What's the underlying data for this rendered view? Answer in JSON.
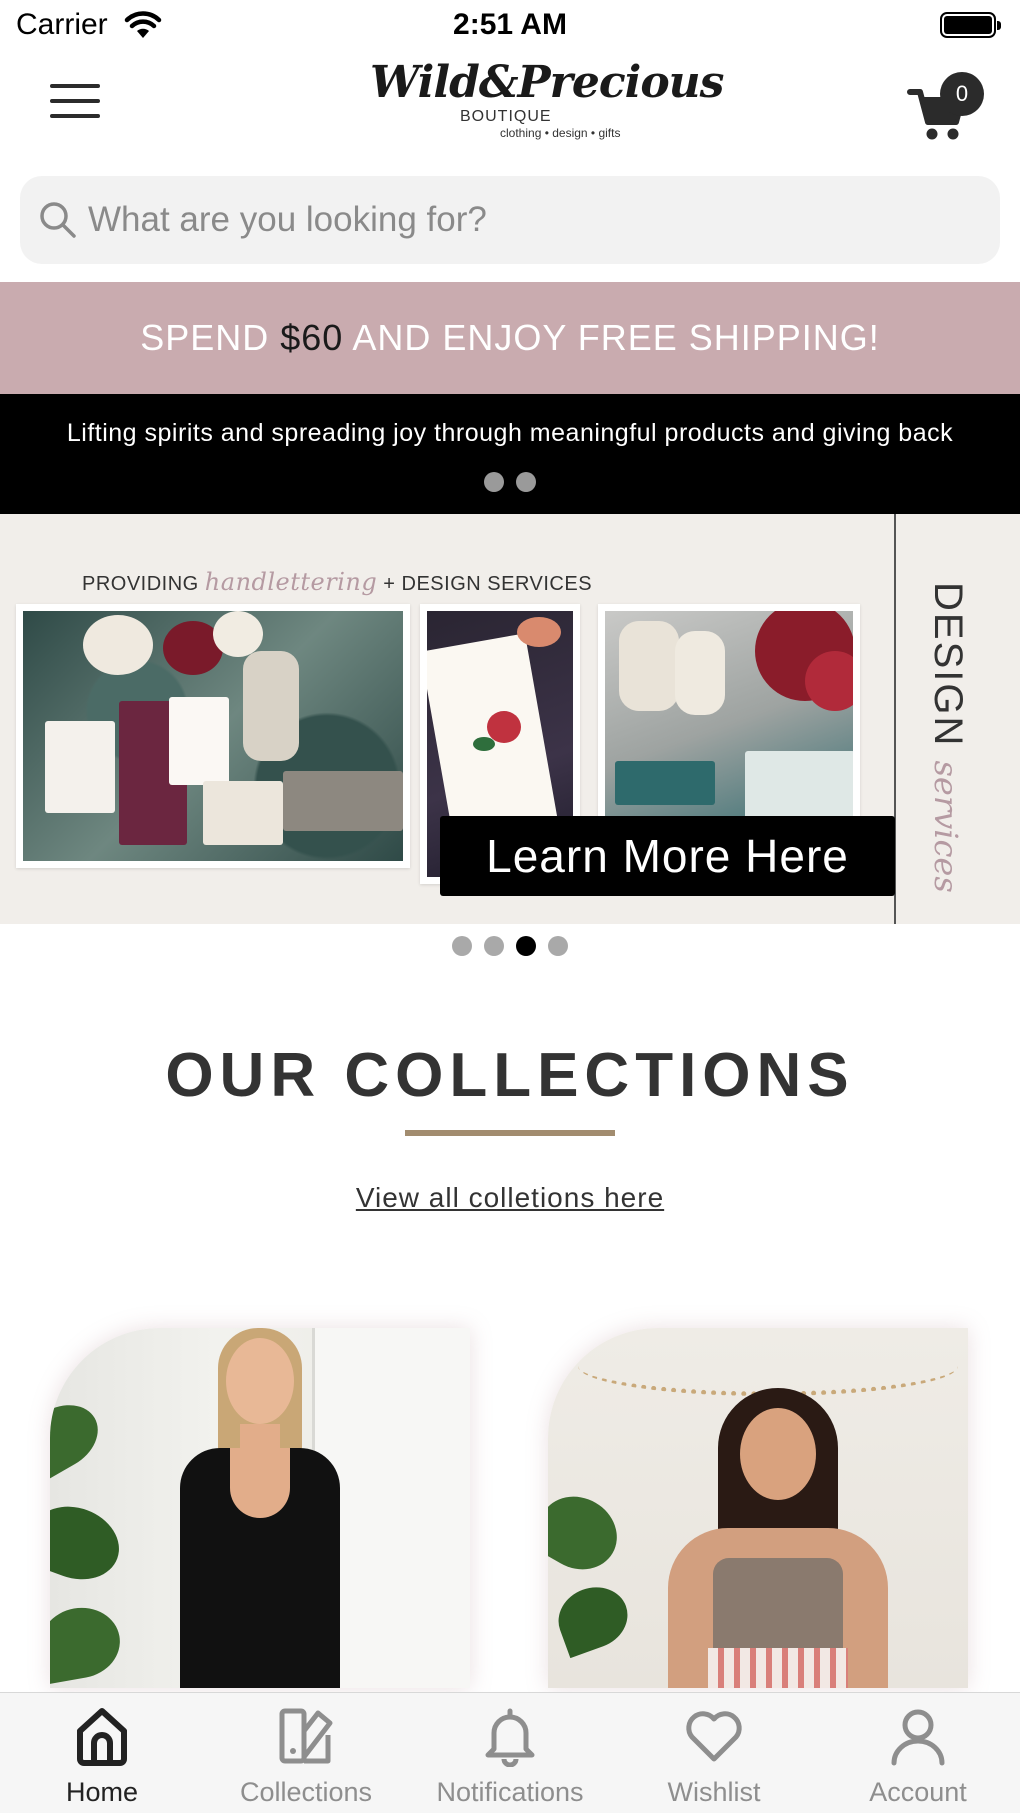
{
  "status_bar": {
    "carrier": "Carrier",
    "time": "2:51 AM"
  },
  "header": {
    "logo_main": "Wild&Precious",
    "logo_sub": "BOUTIQUE",
    "logo_tag": "clothing • design • gifts",
    "cart_count": "0"
  },
  "search": {
    "placeholder": "What are you looking for?"
  },
  "promo": {
    "shipping_prefix": "SPEND ",
    "shipping_amount": "$60",
    "shipping_suffix": " AND ENJOY FREE SHIPPING!",
    "tagline": "Lifting spirits and spreading joy through meaningful products and giving back"
  },
  "hero": {
    "heading_prefix": "PROVIDING ",
    "heading_script": "handlettering",
    "heading_suffix": " + DESIGN SERVICES",
    "side_label": "DESIGN",
    "side_script": "services",
    "button_label": "Learn More Here",
    "active_slide": 3,
    "slide_count": 4
  },
  "collections": {
    "title": "OUR COLLECTIONS",
    "view_all": "View all colletions here"
  },
  "tabbar": {
    "items": [
      {
        "label": "Home",
        "icon": "home-icon",
        "active": true
      },
      {
        "label": "Collections",
        "icon": "collections-icon",
        "active": false
      },
      {
        "label": "Notifications",
        "icon": "bell-icon",
        "active": false
      },
      {
        "label": "Wishlist",
        "icon": "heart-icon",
        "active": false
      },
      {
        "label": "Account",
        "icon": "user-icon",
        "active": false
      }
    ]
  },
  "colors": {
    "promo_pink": "#c9abaf",
    "accent_gold": "#a28c6f",
    "script_pink": "#b59aa2",
    "tab_active": "#222222",
    "tab_inactive": "#8e8e8e"
  }
}
